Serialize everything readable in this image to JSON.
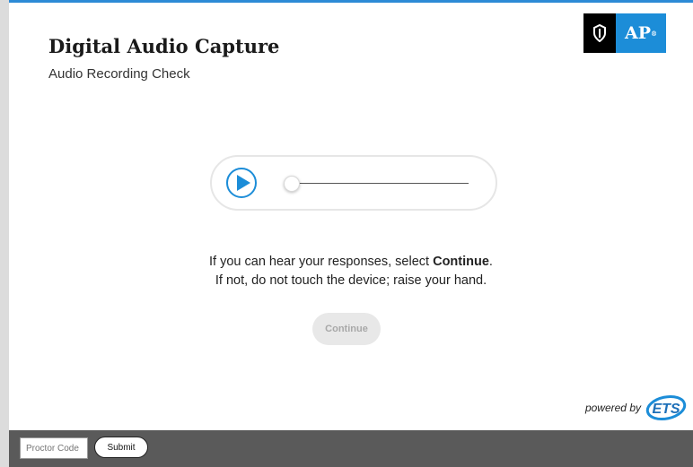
{
  "header": {
    "title": "Digital Audio Capture",
    "subtitle": "Audio Recording Check",
    "brand_label": "AP",
    "brand_mark": "®"
  },
  "player": {
    "play_icon": "play-icon",
    "progress": 0
  },
  "message": {
    "line1_prefix": "If you can hear your responses, select ",
    "line1_bold": "Continue",
    "line1_suffix": ".",
    "line2": "If not, do not touch the device; raise your hand."
  },
  "continue_button": {
    "label": "Continue",
    "enabled": false
  },
  "powered_by": {
    "prefix": "powered by",
    "logo": "ETS"
  },
  "footer": {
    "proctor_placeholder": "Proctor Code",
    "submit_label": "Submit"
  },
  "colors": {
    "accent": "#1c8dd8",
    "footer_bg": "#5a5a5a",
    "disabled": "#e8e8e8"
  }
}
